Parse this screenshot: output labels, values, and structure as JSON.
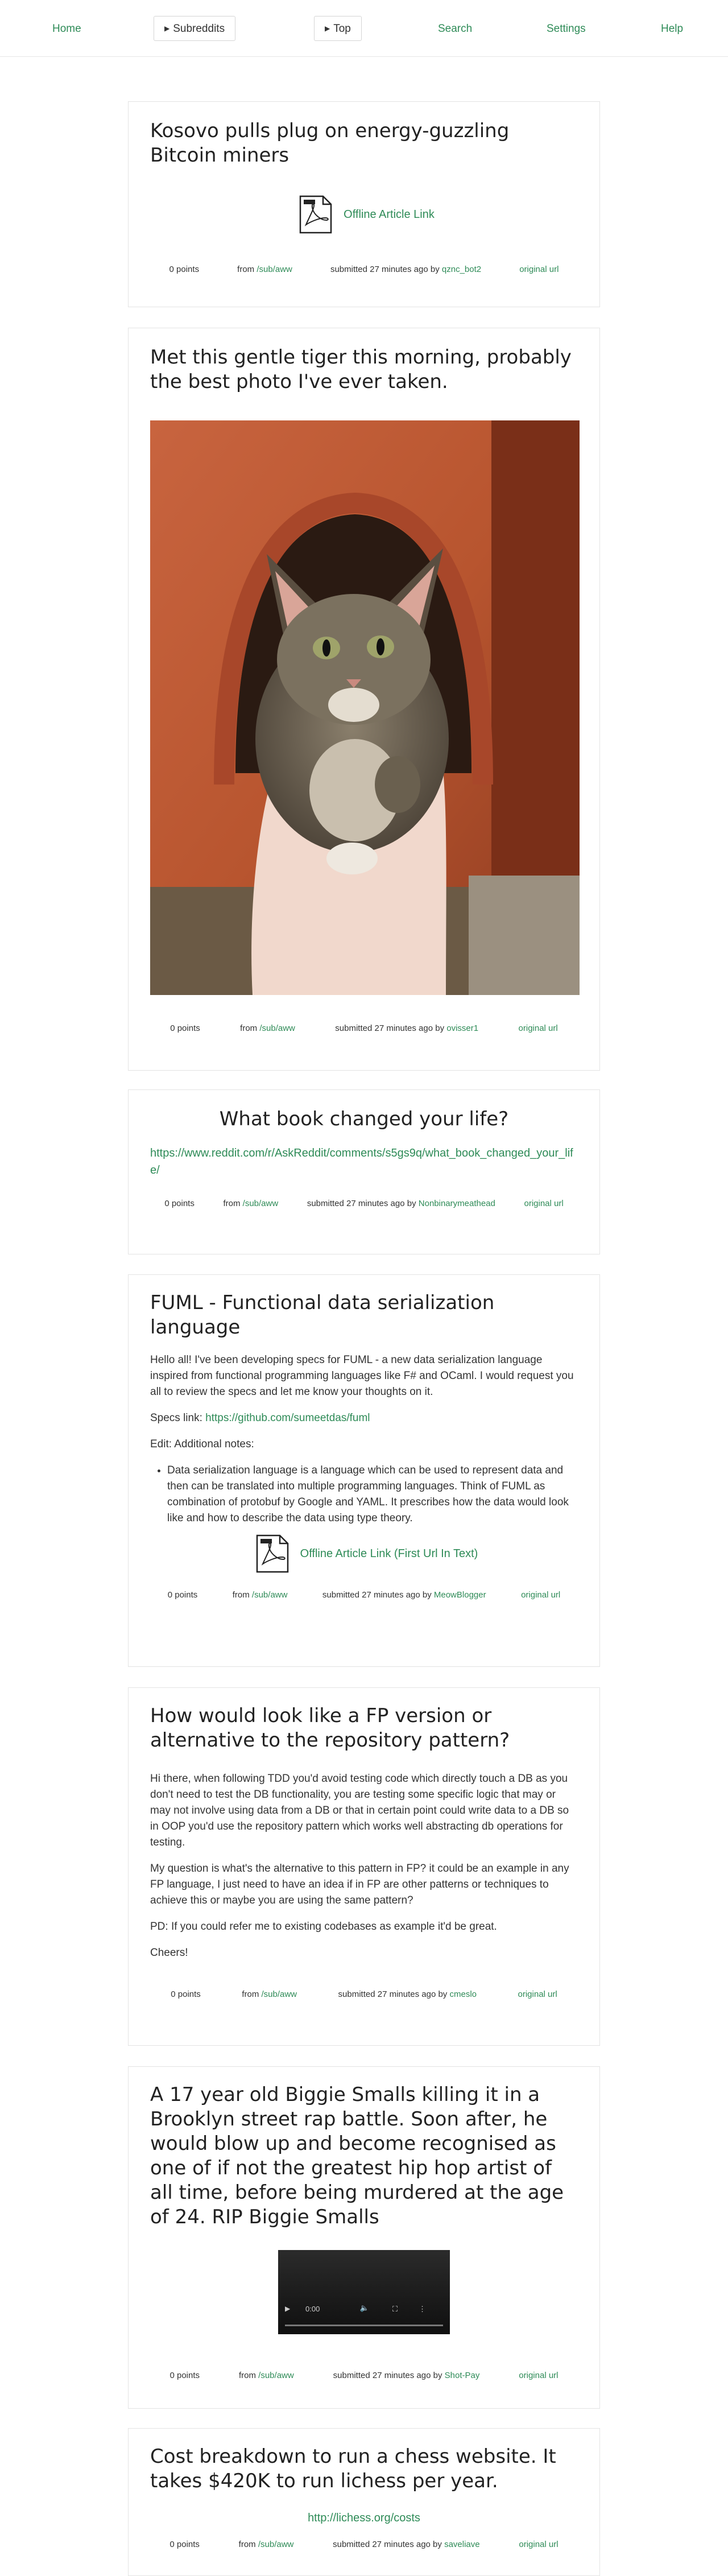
{
  "nav": {
    "home": "Home",
    "subreddits": "Subreddits",
    "top": "Top",
    "search": "Search",
    "settings": "Settings",
    "help": "Help"
  },
  "posts": [
    {
      "title": "Kosovo pulls plug on energy-guzzling Bitcoin miners",
      "link_label": "Offline Article Link",
      "points": "0 points",
      "from_prefix": "from",
      "sub": "/sub/aww",
      "submitted": "submitted 27 minutes ago by",
      "author": "qznc_bot2",
      "original": "original url"
    },
    {
      "title": "Met this gentle tiger this morning, probably the best photo I've ever taken.",
      "points": "0 points",
      "from_prefix": "from",
      "sub": "/sub/aww",
      "submitted": "submitted 27 minutes ago by",
      "author": "ovisser1",
      "original": "original url"
    },
    {
      "title": "What book changed your life?",
      "url": "https://www.reddit.com/r/AskReddit/comments/s5gs9q/what_book_changed_your_life/",
      "points": "0 points",
      "from_prefix": "from",
      "sub": "/sub/aww",
      "submitted": "submitted 27 minutes ago by",
      "author": "Nonbinarymeathead",
      "original": "original url"
    },
    {
      "title": "FUML - Functional data serialization language",
      "para1": "Hello all! I've been developing specs for FUML - a new data serialization language inspired from functional programming languages like F# and OCaml. I would request you all to review the specs and let me know your thoughts on it.",
      "specs_prefix": "Specs link: ",
      "specs_link": "https://github.com/sumeetdas/fuml",
      "edit": "Edit: Additional notes:",
      "bullet": "Data serialization language is a language which can be used to represent data and then can be translated into multiple programming languages. Think of FUML as combination of protobuf by Google and YAML. It prescribes how the data would look like and how to describe the data using type theory.",
      "link_label": "Offline Article Link (First Url In Text)",
      "points": "0 points",
      "from_prefix": "from",
      "sub": "/sub/aww",
      "submitted": "submitted 27 minutes ago by",
      "author": "MeowBlogger",
      "original": "original url"
    },
    {
      "title": "How would look like a FP version or alternative to the repository pattern?",
      "para1": "Hi there, when following TDD you'd avoid testing code which directly touch a DB as you don't need to test the DB functionality, you are testing some specific logic that may or may not involve using data from a DB or that in certain point could write data to a DB so in OOP you'd use the repository pattern which works well abstracting db operations for testing.",
      "para2": "My question is what's the alternative to this pattern in FP? it could be an example in any FP language, I just need to have an idea if in FP are other patterns or techniques to achieve this or maybe you are using the same pattern?",
      "para3": "PD: If you could refer me to existing codebases as example it'd be great.",
      "para4": "Cheers!",
      "points": "0 points",
      "from_prefix": "from",
      "sub": "/sub/aww",
      "submitted": "submitted 27 minutes ago by",
      "author": "cmeslo",
      "original": "original url"
    },
    {
      "title": "A 17 year old Biggie Smalls killing it in a Brooklyn street rap battle. Soon after, he would blow up and become recognised as one of if not the greatest hip hop artist of all time, before being murdered at the age of 24. RIP Biggie Smalls",
      "video_time": "0:00",
      "points": "0 points",
      "from_prefix": "from",
      "sub": "/sub/aww",
      "submitted": "submitted 27 minutes ago by",
      "author": "Shot-Pay",
      "original": "original url"
    },
    {
      "title": "Cost breakdown to run a chess website. It takes $420K to run lichess per year.",
      "url": "http://lichess.org/costs",
      "points": "0 points",
      "from_prefix": "from",
      "sub": "/sub/aww",
      "submitted": "submitted 27 minutes ago by",
      "author": "saveliave",
      "original": "original url"
    }
  ]
}
